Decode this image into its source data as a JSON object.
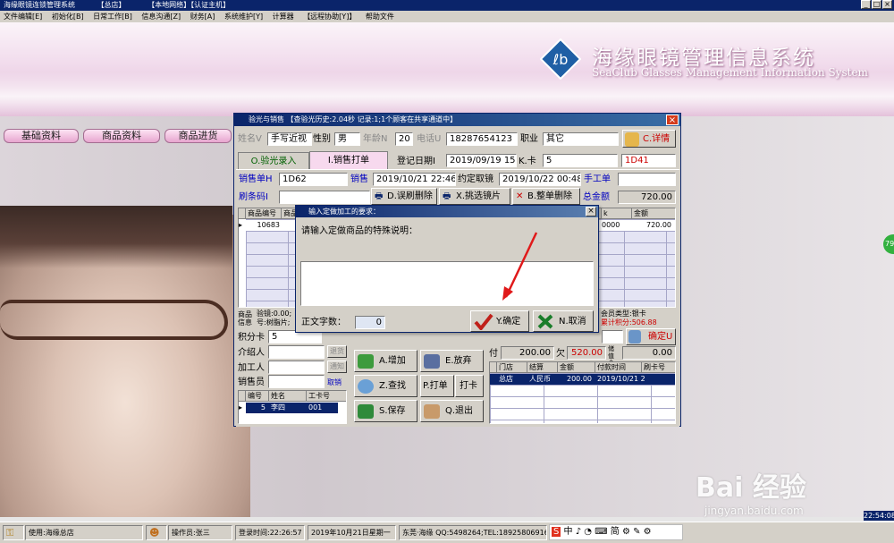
{
  "app": {
    "title_parts": [
      "海缘眼镜连锁管理系统",
      "【总店】",
      "【本地网络】【认证主机】"
    ],
    "min": "_",
    "max": "□",
    "close": "×"
  },
  "menu": [
    "文件编辑[E]",
    "初始化[B]",
    "日常工作[B]",
    "信息沟通[Z]",
    "财务[A]",
    "系统维护[Y]",
    "计算器",
    "【远程协助[Y]】",
    "帮助文件"
  ],
  "banner": {
    "title_cn": "海缘眼镜管理信息系统",
    "title_en": "SeaClub Glasses Management Information System",
    "brand_color": "#1f5fa5"
  },
  "side_buttons": [
    "基础资料",
    "商品资料",
    "商品进货"
  ],
  "right_badge": "79",
  "window": {
    "title": "验光与销售  【查验光历史:2.04秒  记录:1;1个顾客在共享通道中】",
    "close": "×",
    "name_label": "姓名V",
    "name_value": "手写近视",
    "gender_label": "性别",
    "gender_value": "男",
    "age_label": "年龄N",
    "age_value": "20",
    "phone_label": "电话U",
    "phone_value": "18287654123",
    "job_label": "职业",
    "job_value": "其它",
    "detail_btn": "C.详情",
    "tab_optometry": "O.验光录入",
    "tab_sales": "I.销售打单",
    "regdate_label": "登记日期I",
    "regdate_value": "2019/09/19 15",
    "card_label": "K.卡",
    "card_value": "5",
    "card_code": "1D41",
    "order_label": "销售单H",
    "order_value": "1D62",
    "sale_label": "销售",
    "sale_value": "2019/10/21 22:46",
    "pickup_label": "约定取镜",
    "pickup_value": "2019/10/22 00:48",
    "manual_label": "手工单",
    "scan_label": "刷条码I",
    "delete_scan_btn": "D.误刷删除",
    "pick_lens_btn": "X.挑选镜片",
    "delete_order_btn": "B.整单删除",
    "total_label": "总金额",
    "total_value": "720.00",
    "items_grid": {
      "headers": [
        "商品编号",
        "商品",
        "k",
        "金额"
      ],
      "row": {
        "code": "10683",
        "k": "0000",
        "amount": "720.00"
      }
    },
    "product_info": "商品信息",
    "optometry_line1": "验镜:0.00;",
    "optometry_line2": "号:树脂片;",
    "member_type": "会员类型:银卡",
    "points": "累计积分:506.88",
    "points_card_label": "积分卡",
    "points_card_value": "5",
    "confirm_btn": "确定U",
    "introducer_label": "介绍人",
    "refund_btn": "退货",
    "processor_label": "加工人",
    "notify_btn": "通知",
    "salesperson_label": "销售员",
    "cancel_small": "取销",
    "staff_grid": {
      "headers": [
        "编号",
        "姓名",
        "工卡号"
      ],
      "row": {
        "id": "5",
        "name": "李四",
        "card": "001"
      }
    },
    "add_btn": "A.增加",
    "abandon_btn": "E.放弃",
    "find_btn": "Z.查找",
    "print_btn": "P.打单",
    "clock_btn": "打卡",
    "save_btn": "S.保存",
    "exit_btn": "Q.退出",
    "pay_label": "付",
    "pay_value": "200.00",
    "owe_label": "欠",
    "owe_value": "520.00",
    "balance_label": "储值余额",
    "balance_value": "0.00",
    "pay_grid": {
      "headers": [
        "门店",
        "结算",
        "金额",
        "付款时间",
        "刷卡号"
      ],
      "row": {
        "store": "总店",
        "method": "人民币",
        "amount": "200.00",
        "time": "2019/10/21 2"
      }
    }
  },
  "popup": {
    "title": "输入定做加工的要求：",
    "close": "×",
    "prompt": "请输入定做商品的特殊说明：",
    "count_label": "正文字数：",
    "count_value": "0",
    "ok_btn": "Y.确定",
    "cancel_btn": "N.取消"
  },
  "status": {
    "user": "使用:海缘总店",
    "operator": "操作员:张三",
    "login": "登录时间:22:26:57",
    "date": "2019年10月21日星期一",
    "contact": "东莞·海缘 QQ:5498264;TEL:18925806916,07",
    "clock": "22:54:08"
  },
  "ime": "中 ♪ ◔ ⌨ 简 ⚙ ✎ ⚙",
  "watermark": {
    "logo": "Bai 经验",
    "url": "jingyan.baidu.com"
  }
}
